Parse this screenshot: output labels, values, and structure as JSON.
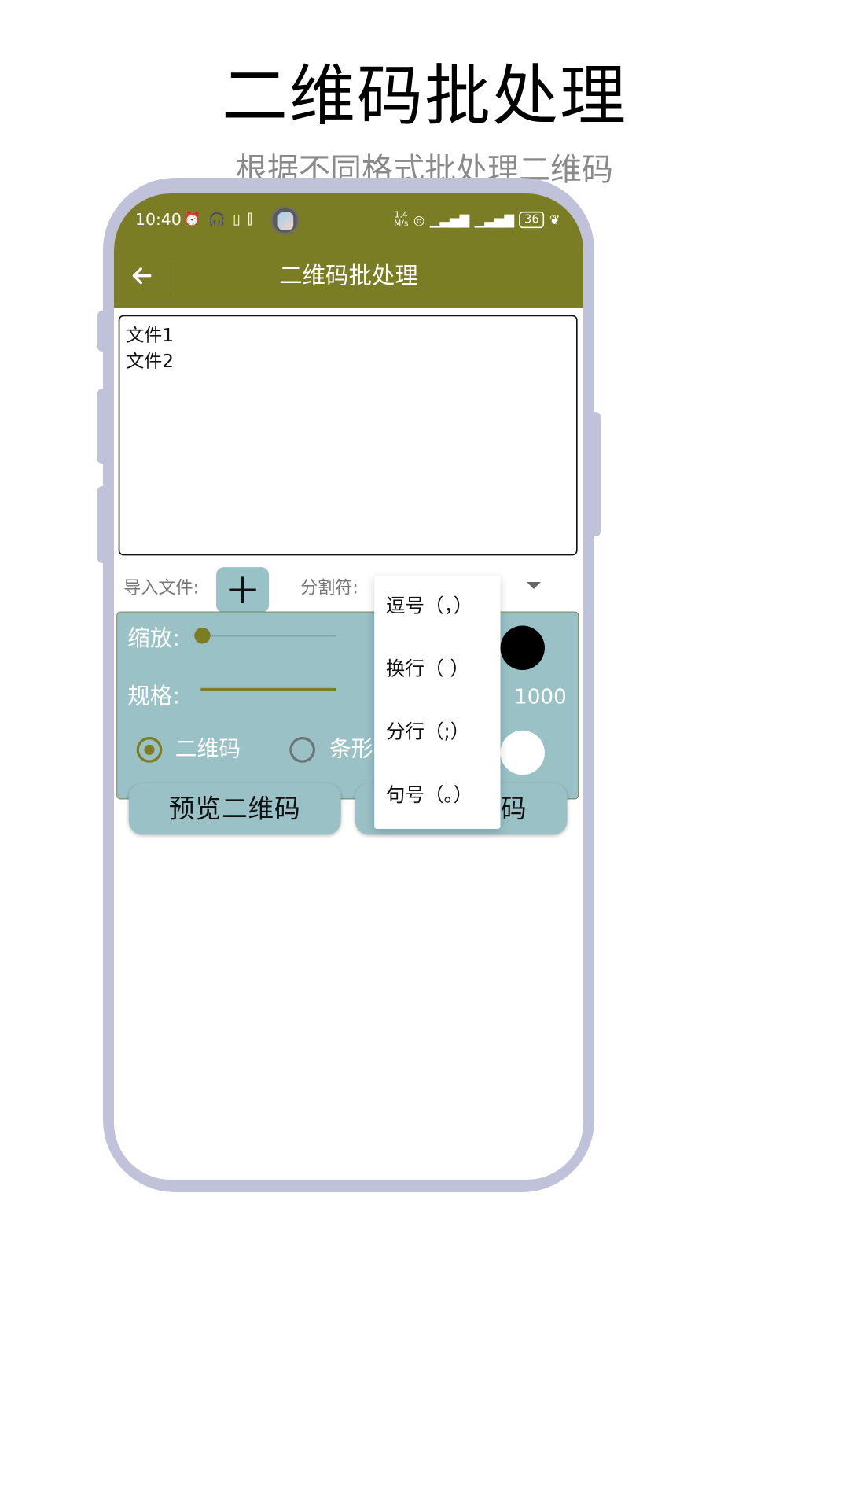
{
  "hero": {
    "title": "二维码批处理",
    "subtitle": "根据不同格式批处理二维码"
  },
  "status_bar": {
    "time": "10:40",
    "left_icons": [
      "alarm-icon",
      "headphones-icon",
      "battery-saver-icon",
      "vibrate-icon"
    ],
    "net_speed_value": "1.4",
    "net_speed_unit": "M/s",
    "right_icons": [
      "hotspot-icon",
      "5g-signal-icon",
      "5g-signal-icon"
    ],
    "battery": "36",
    "leaf_icon": "leaf-icon"
  },
  "app_bar": {
    "title": "二维码批处理",
    "back_icon": "arrow-left-icon"
  },
  "content_box": {
    "lines": [
      "文件1",
      "文件2"
    ]
  },
  "import": {
    "label": "导入文件:",
    "add_icon": "plus-icon"
  },
  "separator": {
    "label": "分割符:",
    "options": [
      "逗号（，）",
      "换行（ ）",
      "分行（;）",
      "句号（。）"
    ]
  },
  "panel": {
    "zoom_label": "缩放:",
    "zoom_level": 0,
    "size_label": "规格:",
    "size_value": "1000",
    "radio_qr_label": "二维码",
    "radio_qr_selected": true,
    "radio_barcode_label": "条形码",
    "radio_barcode_selected": false,
    "preview_button": "预览二维码",
    "generate_button": "生成二维码"
  },
  "colors": {
    "accent": "#7a7d24",
    "panel_bg": "#99c1c6",
    "frame": "#bfc2d8"
  }
}
